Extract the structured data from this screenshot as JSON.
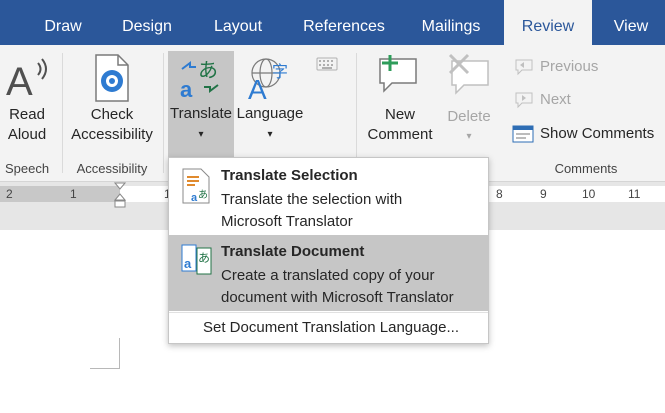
{
  "tabs": [
    {
      "label": "Draw",
      "active": false
    },
    {
      "label": "Design",
      "active": false
    },
    {
      "label": "Layout",
      "active": false
    },
    {
      "label": "References",
      "active": false
    },
    {
      "label": "Mailings",
      "active": false
    },
    {
      "label": "Review",
      "active": true
    },
    {
      "label": "View",
      "active": false
    }
  ],
  "ribbon": {
    "speech": {
      "read_aloud_line1": "Read",
      "read_aloud_line2": "Aloud",
      "group_label": "Speech"
    },
    "accessibility": {
      "check_line1": "Check",
      "check_line2": "Accessibility",
      "group_label": "Accessibility"
    },
    "language": {
      "translate_label": "Translate",
      "language_label": "Language"
    },
    "comments": {
      "new_line1": "New",
      "new_line2": "Comment",
      "delete_label": "Delete",
      "previous_label": "Previous",
      "next_label": "Next",
      "show_comments_label": "Show Comments",
      "group_label": "Comments"
    }
  },
  "ruler": {
    "numbers": [
      "2",
      "1",
      "1",
      "1",
      "2",
      "3",
      "4",
      "5",
      "6",
      "7",
      "8",
      "9",
      "10",
      "11"
    ]
  },
  "translate_menu": {
    "selection": {
      "title": "Translate Selection",
      "desc_line1": "Translate the selection with",
      "desc_line2": "Microsoft Translator"
    },
    "document": {
      "title": "Translate Document",
      "desc_line1": "Create a translated copy of your",
      "desc_line2": "document with Microsoft Translator"
    },
    "set_language": "Set Document Translation Language..."
  },
  "colors": {
    "accent": "#2b579a",
    "ribbon_bg": "#f3f3f3",
    "hover": "#c6c6c6",
    "translate_pressed": "#c6c6c6"
  }
}
